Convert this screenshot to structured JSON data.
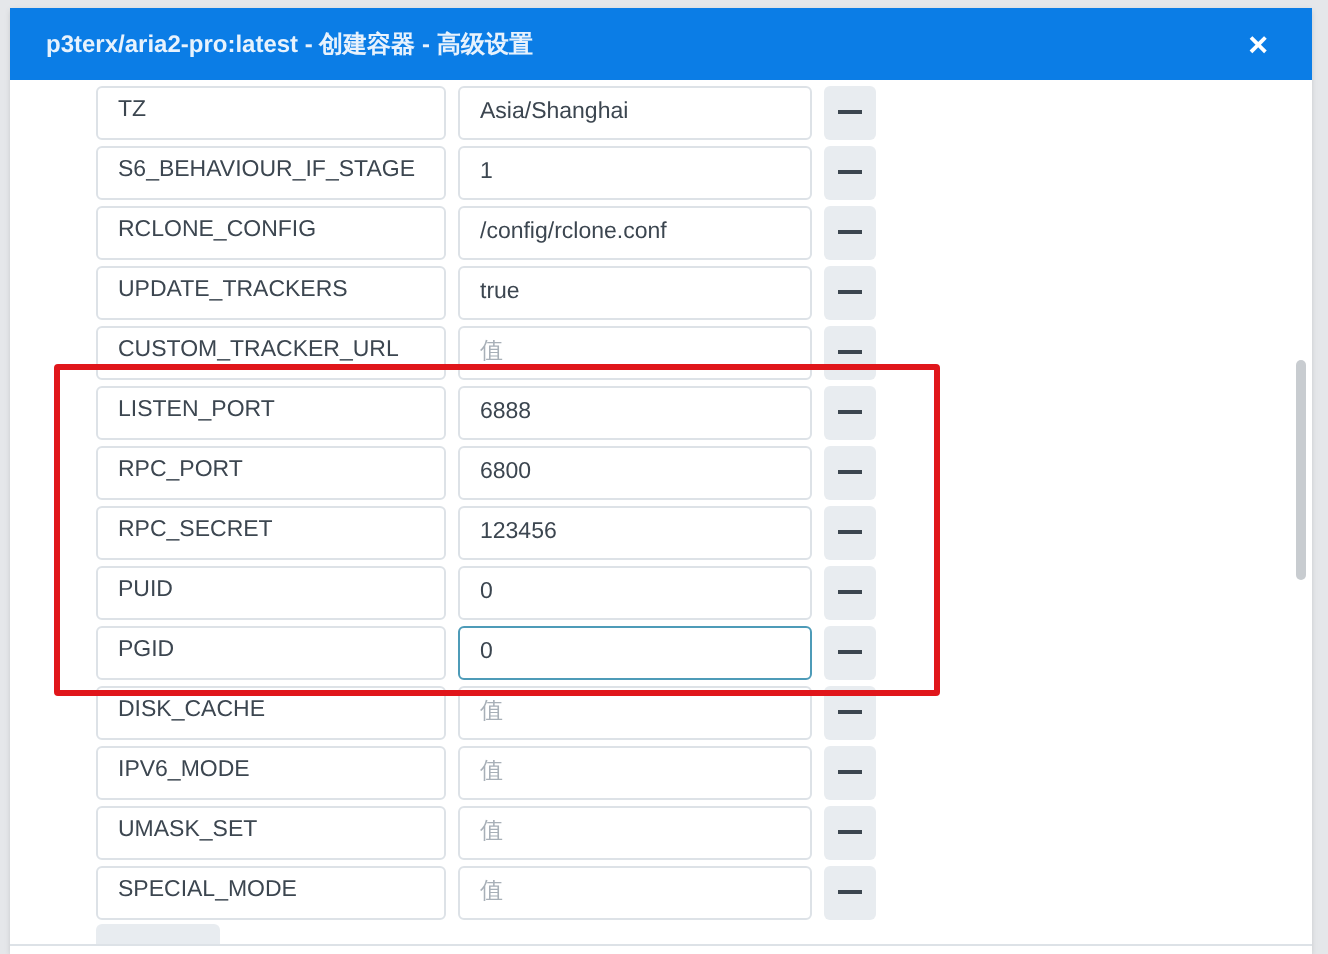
{
  "window": {
    "title": "p3terx/aria2-pro:latest - 创建容器 - 高级设置",
    "close": "×"
  },
  "variables": [
    {
      "key": "TZ",
      "value": "Asia/Shanghai",
      "highlighted": false,
      "focused": false
    },
    {
      "key": "S6_BEHAVIOUR_IF_STAGE",
      "value": "1",
      "highlighted": false,
      "focused": false
    },
    {
      "key": "RCLONE_CONFIG",
      "value": "/config/rclone.conf",
      "highlighted": false,
      "focused": false
    },
    {
      "key": "UPDATE_TRACKERS",
      "value": "true",
      "highlighted": false,
      "focused": false
    },
    {
      "key": "CUSTOM_TRACKER_URL",
      "placeholder": "值",
      "highlighted": false,
      "focused": false
    },
    {
      "key": "LISTEN_PORT",
      "value": "6888",
      "highlighted": true,
      "focused": false
    },
    {
      "key": "RPC_PORT",
      "value": "6800",
      "highlighted": true,
      "focused": false
    },
    {
      "key": "RPC_SECRET",
      "value": "123456",
      "highlighted": true,
      "focused": false
    },
    {
      "key": "PUID",
      "value": "0",
      "highlighted": true,
      "focused": false
    },
    {
      "key": "PGID",
      "value": "0",
      "highlighted": true,
      "focused": true
    },
    {
      "key": "DISK_CACHE",
      "placeholder": "值",
      "highlighted": false,
      "focused": false
    },
    {
      "key": "IPV6_MODE",
      "placeholder": "值",
      "highlighted": false,
      "focused": false
    },
    {
      "key": "UMASK_SET",
      "placeholder": "值",
      "highlighted": false,
      "focused": false
    },
    {
      "key": "SPECIAL_MODE",
      "placeholder": "值",
      "highlighted": false,
      "focused": false
    }
  ]
}
